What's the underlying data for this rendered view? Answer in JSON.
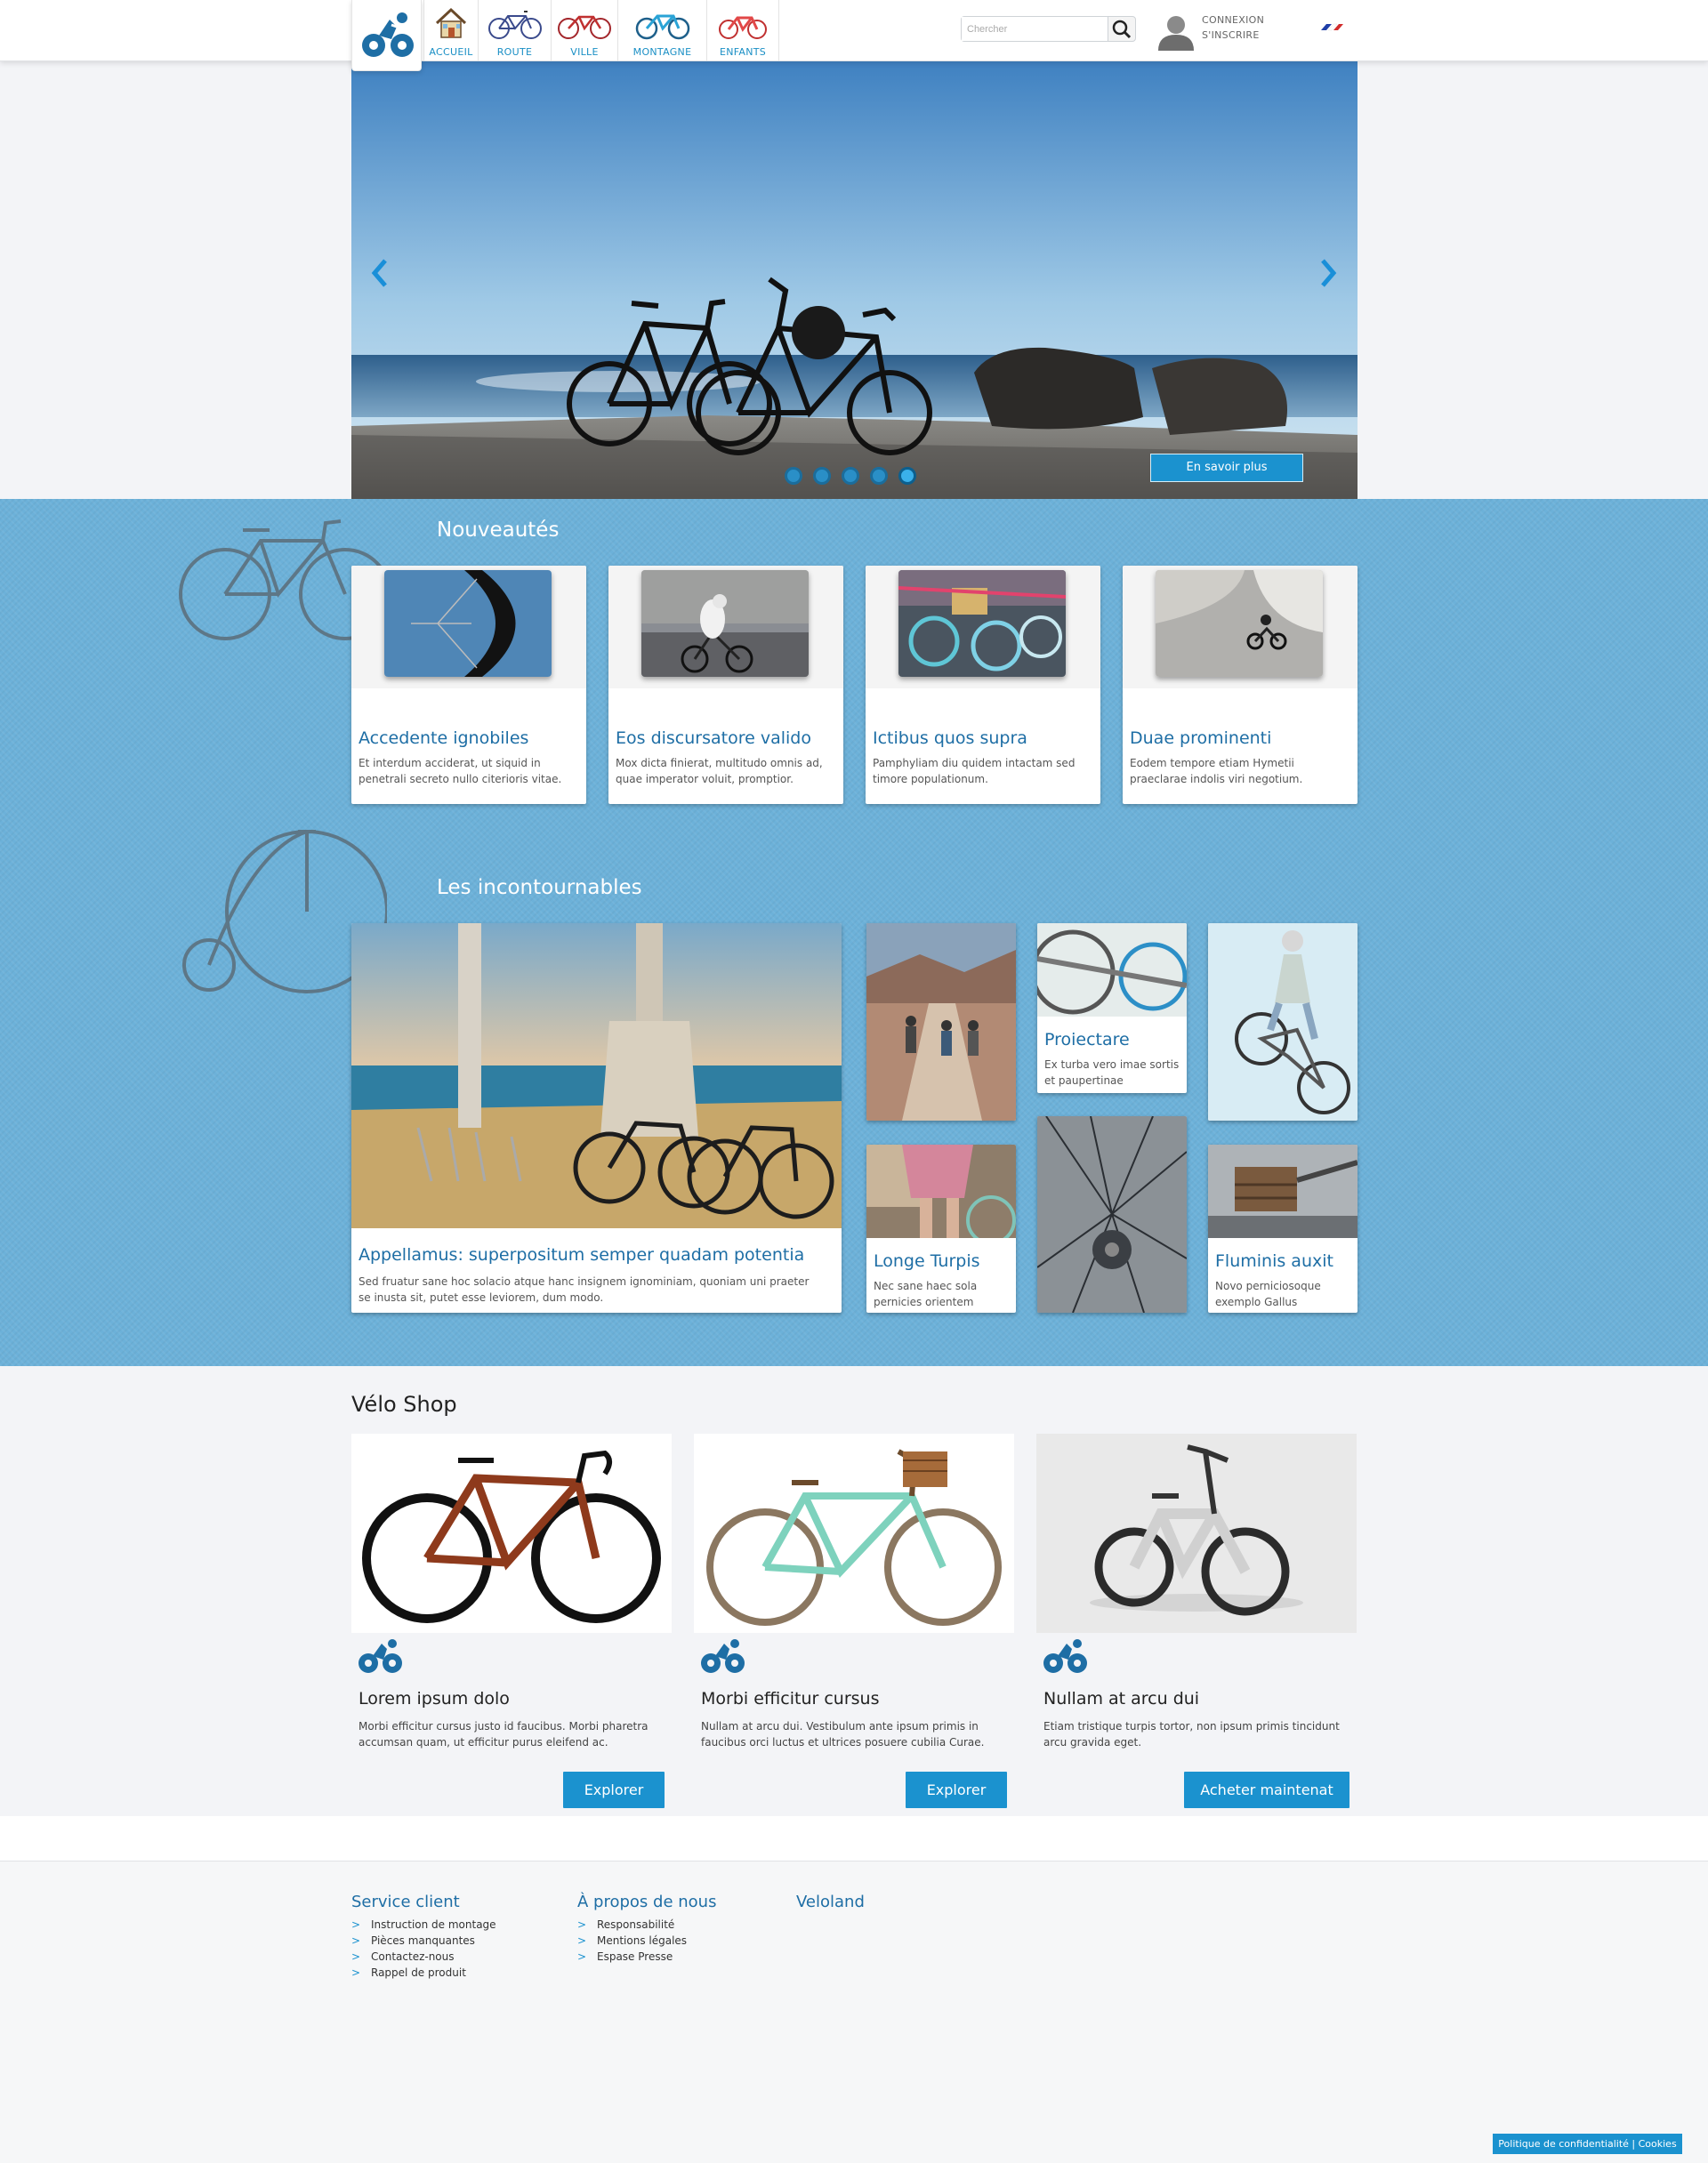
{
  "nav": {
    "items": [
      {
        "label": "ACCUEIL",
        "icon": "house-icon"
      },
      {
        "label": "ROUTE",
        "icon": "road-bike-icon"
      },
      {
        "label": "VILLE",
        "icon": "city-bike-icon"
      },
      {
        "label": "MONTAGNE",
        "icon": "mountain-bike-icon"
      },
      {
        "label": "ENFANTS",
        "icon": "kids-bike-icon"
      }
    ]
  },
  "search": {
    "placeholder": "Chercher"
  },
  "user": {
    "login": "CONNEXION",
    "register": "S'INSCRIRE"
  },
  "hero": {
    "cta": "En savoir plus",
    "slides": 5,
    "active_slide": 5
  },
  "nouveautes": {
    "title": "Nouveautés",
    "cards": [
      {
        "title": "Accedente ignobiles",
        "desc": "Et interdum acciderat, ut siquid in penetrali secreto nullo citerioris vitae."
      },
      {
        "title": "Eos discursatore valido",
        "desc": "Mox dicta finierat, multitudo omnis ad, quae imperator voluit, promptior."
      },
      {
        "title": "Ictibus quos supra",
        "desc": "Pamphyliam diu quidem intactam sed timore populationum."
      },
      {
        "title": "Duae prominenti",
        "desc": "Eodem tempore etiam Hymetii praeclarae indolis viri negotium."
      }
    ]
  },
  "incontournables": {
    "title": "Les incontournables",
    "feature": {
      "title": "Appellamus: superpositum semper quadam potentia",
      "desc": "Sed fruatur sane hoc solacio atque hanc insignem ignominiam, quoniam uni praeter se inusta sit, putet esse leviorem, dum modo."
    },
    "tiles": [
      {
        "title": "Proiectare",
        "desc": "Ex turba vero imae sortis et paupertinae"
      },
      {
        "title": "Longe Turpis",
        "desc": "Nec sane haec sola pernicies orientem"
      },
      {
        "title": "Fluminis auxit",
        "desc": "Novo perniciosoque exemplo Gallus"
      }
    ]
  },
  "shop": {
    "title": "Vélo Shop",
    "products": [
      {
        "name": "Lorem ipsum dolo",
        "desc": "Morbi efficitur cursus justo id faucibus. Morbi pharetra accumsan quam, ut efficitur purus eleifend ac.",
        "button": "Explorer"
      },
      {
        "name": "Morbi efficitur cursus",
        "desc": "Nullam at arcu dui. Vestibulum ante ipsum primis in faucibus orci luctus et ultrices posuere cubilia Curae.",
        "button": "Explorer"
      },
      {
        "name": "Nullam at arcu dui",
        "desc": "Etiam tristique turpis tortor, non ipsum primis tincidunt arcu gravida eget.",
        "button": "Acheter maintenat"
      }
    ]
  },
  "footer": {
    "columns": [
      {
        "title": "Service client",
        "links": [
          "Instruction de montage",
          "Pièces manquantes",
          "Contactez-nous",
          "Rappel de produit"
        ]
      },
      {
        "title": "À propos de nous",
        "links": [
          "Responsabilité",
          "Mentions légales",
          "Espase Presse"
        ]
      },
      {
        "title": "Veloland",
        "links": []
      }
    ],
    "cookie": "Politique de confidentialité | Cookies"
  },
  "colors": {
    "accent": "#1b92cf",
    "band": "#6cb1d9",
    "title_blue": "#1e6ea5"
  }
}
